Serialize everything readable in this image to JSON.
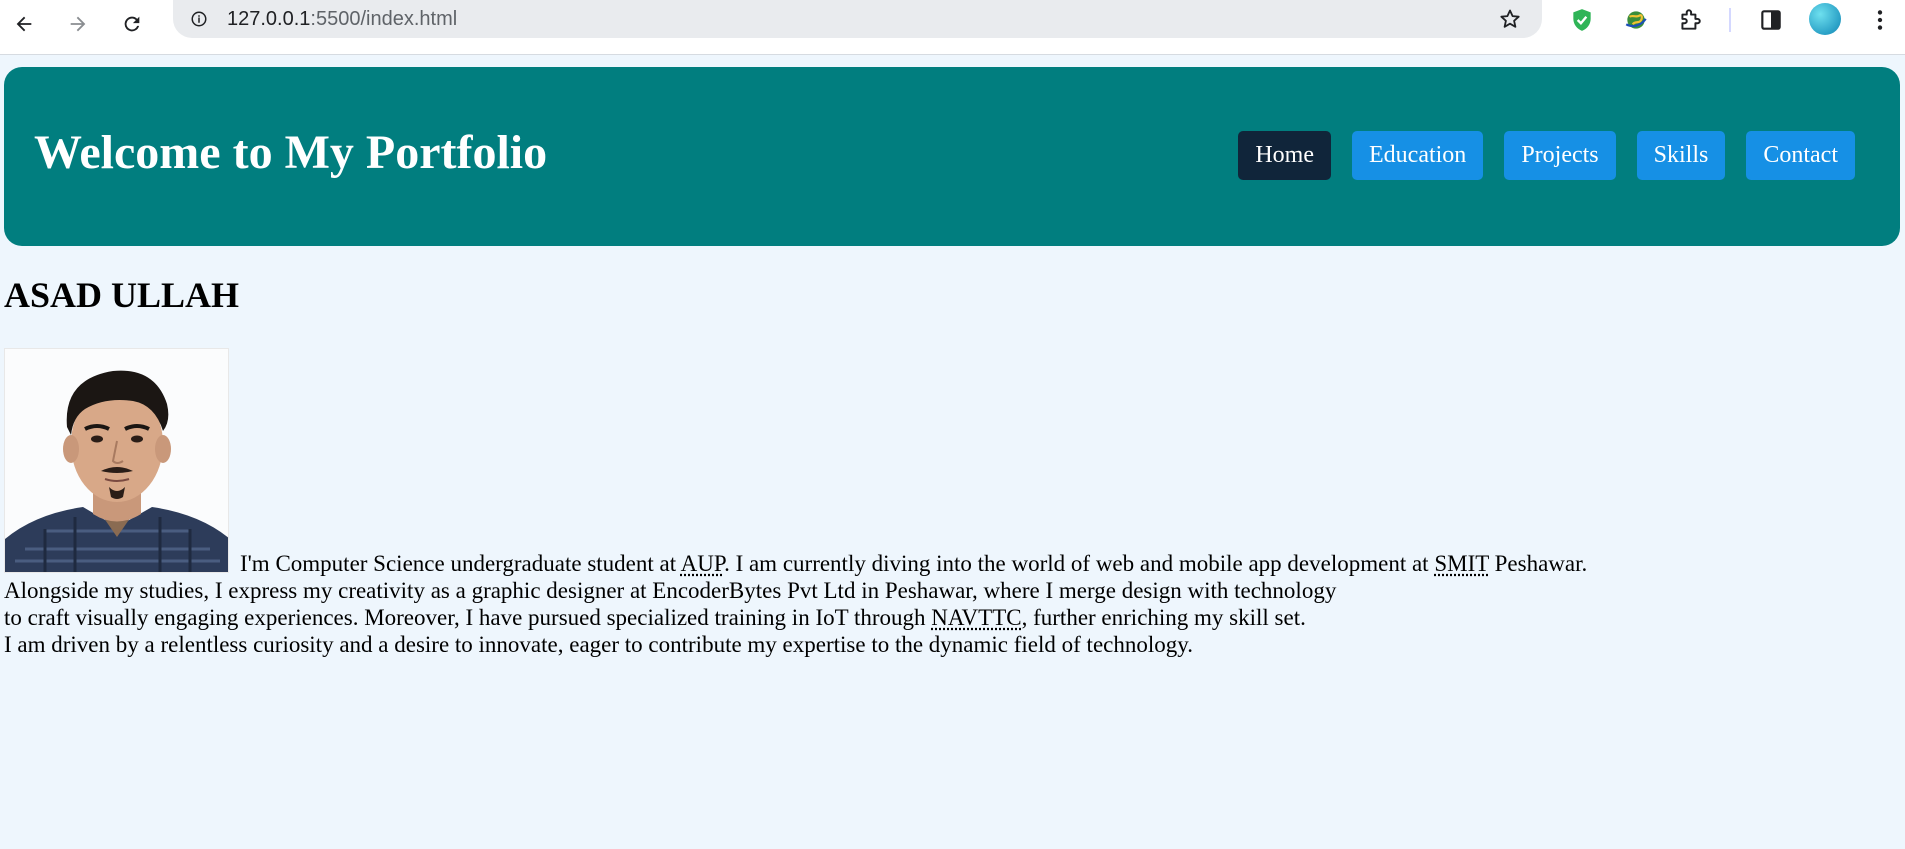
{
  "browser": {
    "url_host": "127.0.0.1",
    "url_rest": ":5500/index.html",
    "icons": {
      "back": "arrow-left-icon",
      "forward": "arrow-right-icon",
      "reload": "reload-icon",
      "site_info": "info-icon",
      "bookmark": "star-icon",
      "extensions": [
        "shield-check-icon",
        "globe-icon",
        "puzzle-icon",
        "side-panel-icon"
      ],
      "profile": "avatar",
      "menu": "kebab-menu-icon"
    }
  },
  "header": {
    "title": "Welcome to My Portfolio",
    "background_color": "#017e7f",
    "nav": [
      {
        "label": "Home",
        "active": true
      },
      {
        "label": "Education",
        "active": false
      },
      {
        "label": "Projects",
        "active": false
      },
      {
        "label": "Skills",
        "active": false
      },
      {
        "label": "Contact",
        "active": false
      }
    ],
    "nav_color": "#1690e5",
    "nav_active_color": "#10253a"
  },
  "main": {
    "name": "ASAD ULLAH",
    "photo": "profile-photo",
    "bio": {
      "p1_a": "I'm Computer Science undergraduate student at ",
      "abbr1": "AUP",
      "p1_b": ". I am currently diving into the world of web and mobile app development at ",
      "abbr2": "SMIT",
      "p1_c": " Peshawar.",
      "line2": "Alongside my studies, I express my creativity as a graphic designer at EncoderBytes Pvt Ltd in Peshawar, where I merge design with technology",
      "line3_a": "to craft visually engaging experiences. Moreover, I have pursued specialized training in IoT through ",
      "abbr3": "NAVTTC",
      "line3_b": ", further enriching my skill set.",
      "line4": "I am driven by a relentless curiosity and a desire to innovate, eager to contribute my expertise to the dynamic field of technology."
    }
  }
}
